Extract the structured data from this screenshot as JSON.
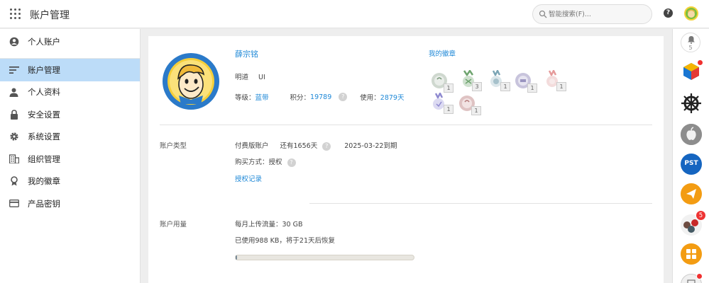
{
  "header": {
    "title": "账户管理",
    "search_placeholder": "智能搜索(F)..."
  },
  "sidebar": {
    "items": [
      {
        "label": "个人账户",
        "icon": "account-circle-icon"
      },
      {
        "label": "账户管理",
        "icon": "sort-lines-icon"
      },
      {
        "label": "个人资料",
        "icon": "person-icon"
      },
      {
        "label": "安全设置",
        "icon": "lock-icon"
      },
      {
        "label": "系统设置",
        "icon": "gear-icon"
      },
      {
        "label": "组织管理",
        "icon": "building-icon"
      },
      {
        "label": "我的徽章",
        "icon": "medal-icon"
      },
      {
        "label": "产品密钥",
        "icon": "credit-card-icon"
      }
    ]
  },
  "profile": {
    "name": "薛宗铭",
    "org": "明道",
    "dept": "UI",
    "level_label": "等级：",
    "level_value": "蓝带",
    "points_label": "积分：",
    "points_value": "19789",
    "usage_label": "使用：",
    "usage_value": "2879天"
  },
  "badges": {
    "title": "我的徽章",
    "counts": [
      "1",
      "3",
      "1",
      "1",
      "1",
      "1",
      "1"
    ]
  },
  "account_type": {
    "label": "账户类型",
    "plan": "付费版账户",
    "remaining": "还有1656天",
    "expiry": "2025-03-22到期",
    "purchase": "购买方式：授权",
    "auth_link": "授权记录"
  },
  "usage": {
    "label": "账户用量",
    "monthly": "每月上传流量：30 GB",
    "used": "已使用988 KB，将于21天后恢复",
    "progress_fraction": 0.001
  },
  "rail": {
    "notification_count": "5",
    "badge_count": "5",
    "pst_label": "PST"
  },
  "colors": {
    "accent": "#1e88d7",
    "active_nav": "#bcdcf8",
    "rail_orange": "#f39c12",
    "rail_blue": "#1976d2"
  }
}
